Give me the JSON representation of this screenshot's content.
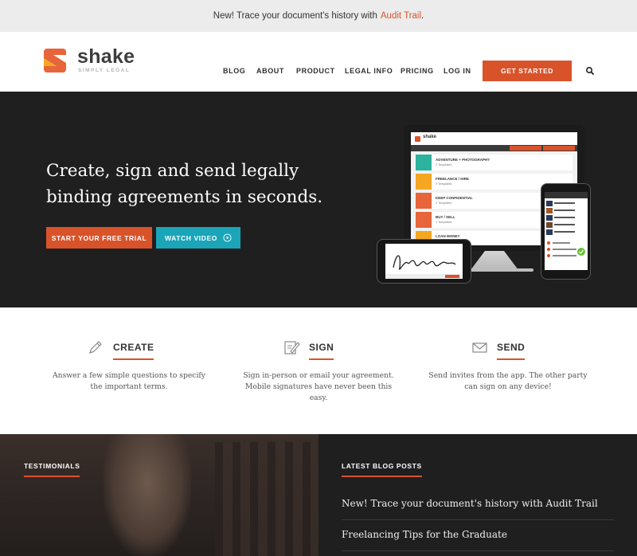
{
  "announcement": {
    "text": "New! Trace your document's history with",
    "link": "Audit Trail",
    "suffix": "."
  },
  "header": {
    "brand": "shake",
    "tagline": "SIMPLY LEGAL",
    "nav": [
      "BLOG",
      "ABOUT",
      "PRODUCT",
      "LEGAL INFO",
      "PRICING",
      "LOG IN"
    ],
    "cta": "GET STARTED",
    "search_icon": "search-icon"
  },
  "hero": {
    "headline": "Create, sign and send legally binding agreements in seconds.",
    "primary_button": "START YOUR FREE TRIAL",
    "secondary_button": "WATCH VIDEO",
    "app_preview": {
      "brand": "shake",
      "rows": [
        {
          "title": "ADVENTURE + PHOTOGRAPHY",
          "sub": "2 Templates",
          "color": "#2bb3a0"
        },
        {
          "title": "FREELANCE / HIRE",
          "sub": "9 Templates",
          "color": "#f5a623"
        },
        {
          "title": "KEEP CONFIDENTIAL",
          "sub": "4 Templates",
          "color": "#e8643a"
        },
        {
          "title": "BUY / SELL",
          "sub": "1 Templates",
          "color": "#e8643a"
        },
        {
          "title": "LOAN MONEY",
          "sub": "",
          "color": "#f5a623"
        }
      ]
    }
  },
  "features": [
    {
      "title": "CREATE",
      "icon": "pencil-icon",
      "desc": "Answer a few simple questions to specify the important terms."
    },
    {
      "title": "SIGN",
      "icon": "sign-document-icon",
      "desc": "Sign in-person or email your agreement. Mobile signatures have never been this easy."
    },
    {
      "title": "SEND",
      "icon": "envelope-icon",
      "desc": "Send invites from the app. The other party can sign on any device!"
    }
  ],
  "testimonials": {
    "label": "TESTIMONIALS"
  },
  "blog": {
    "label": "LATEST BLOG POSTS",
    "posts": [
      "New! Trace your document's history with Audit Trail",
      "Freelancing Tips for the Graduate"
    ]
  },
  "colors": {
    "accent": "#d9532a",
    "teal": "#1aa5b8",
    "hero_bg": "#1f1f1f"
  }
}
